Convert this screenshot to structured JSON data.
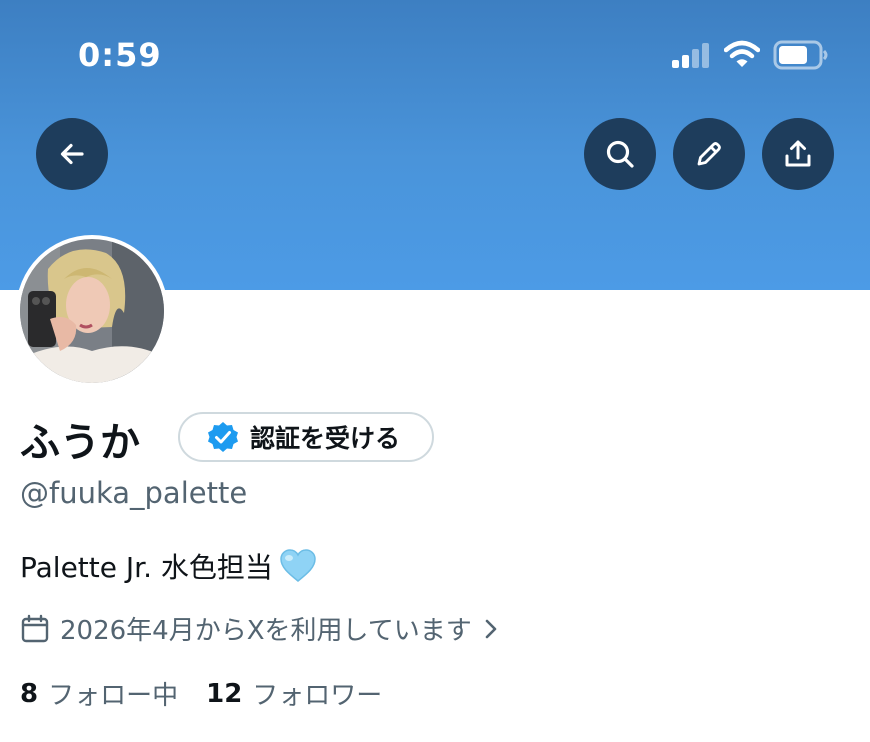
{
  "status_bar": {
    "time": "0:59",
    "icons": [
      "signal-icon",
      "wifi-icon",
      "battery-icon"
    ]
  },
  "header": {
    "buttons": [
      "back-arrow-icon",
      "search-icon",
      "edit-pencil-icon",
      "share-icon"
    ]
  },
  "profile": {
    "display_name": "ふうか",
    "verify_button_label": "認証を受ける",
    "handle": "@fuuka_palette",
    "bio": "Palette Jr. 水色担当",
    "bio_emoji": "light-blue-heart",
    "joined": "2026年4月からXを利用しています",
    "following_count": "8",
    "following_label": "フォロー中",
    "followers_count": "12",
    "followers_label": "フォロワー"
  },
  "colors": {
    "banner": "#4a94da",
    "header_button": "#1e3d5c",
    "verified_badge": "#1d9bf0",
    "secondary_text": "#536471"
  }
}
